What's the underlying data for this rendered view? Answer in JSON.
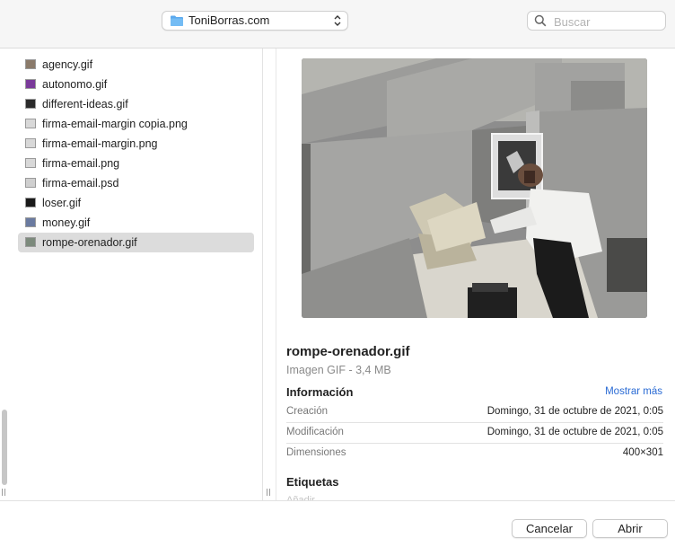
{
  "toolbar": {
    "location_label": "ToniBorras.com",
    "location_icon": "folder-icon",
    "search_placeholder": "Buscar",
    "search_value": ""
  },
  "files": [
    {
      "name": "agency.gif",
      "selected": false
    },
    {
      "name": "autonomo.gif",
      "selected": false
    },
    {
      "name": "different-ideas.gif",
      "selected": false
    },
    {
      "name": "firma-email-margin copia.png",
      "selected": false
    },
    {
      "name": "firma-email-margin.png",
      "selected": false
    },
    {
      "name": "firma-email.png",
      "selected": false
    },
    {
      "name": "firma-email.psd",
      "selected": false
    },
    {
      "name": "loser.gif",
      "selected": false
    },
    {
      "name": "money.gif",
      "selected": false
    },
    {
      "name": "rompe-orenador.gif",
      "selected": true
    }
  ],
  "preview": {
    "title": "rompe-orenador.gif",
    "subtitle": "Imagen GIF - 3,4 MB",
    "info_heading": "Información",
    "show_more": "Mostrar más",
    "meta": [
      {
        "label": "Creación",
        "value": "Domingo, 31 de octubre de 2021, 0:05"
      },
      {
        "label": "Modificación",
        "value": "Domingo, 31 de octubre de 2021, 0:05"
      },
      {
        "label": "Dimensiones",
        "value": "400×301"
      }
    ],
    "tags_heading": "Etiquetas",
    "tags_placeholder": "Añadir..."
  },
  "buttons": {
    "cancel": "Cancelar",
    "open": "Abrir"
  },
  "colors": {
    "accent_link": "#2a6bd4",
    "folder_blue": "#5aa9ee",
    "selection": "#dcdcdc"
  }
}
